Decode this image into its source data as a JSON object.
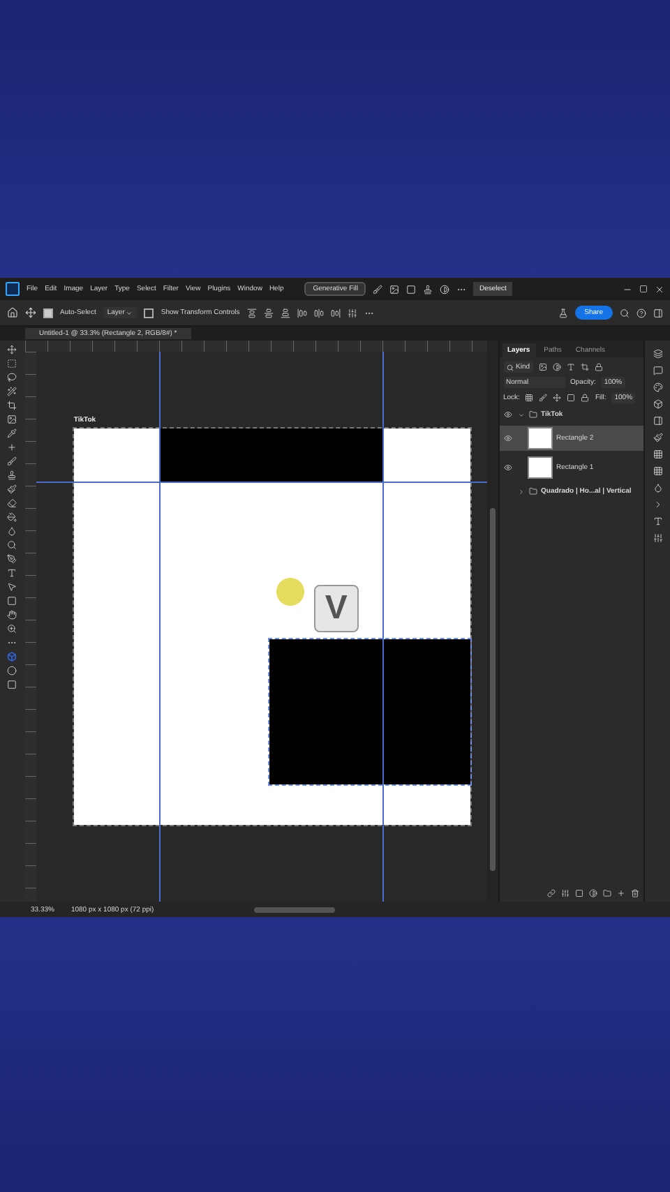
{
  "menu": [
    "File",
    "Edit",
    "Image",
    "Layer",
    "Type",
    "Select",
    "Filter",
    "View",
    "Plugins",
    "Window",
    "Help"
  ],
  "generative_fill": "Generative Fill",
  "deselect": "Deselect",
  "options": {
    "auto_select": {
      "label": "Auto-Select",
      "checked": true
    },
    "target": "Layer",
    "transform": {
      "label": "Show Transform Controls",
      "checked": false
    }
  },
  "share": "Share",
  "document_tab": "Untitled-1 @ 33.3% (Rectangle 2, RGB/8#) *",
  "artboard": {
    "name": "TikTok"
  },
  "key_overlay": "V",
  "layers_panel": {
    "tabs": [
      {
        "label": "Layers",
        "selected": true
      },
      {
        "label": "Paths",
        "selected": false
      },
      {
        "label": "Channels",
        "selected": false
      }
    ],
    "filter": "Kind",
    "blend_mode": "Normal",
    "opacity_label": "Opacity:",
    "opacity": "100%",
    "lock_label": "Lock:",
    "fill_label": "Fill:",
    "fill": "100%",
    "layers": [
      {
        "name": "TikTok",
        "kind": "group",
        "visible": true,
        "expanded": true,
        "selected": false,
        "children": [
          {
            "name": "Rectangle 2",
            "kind": "layer",
            "visible": true,
            "selected": true
          },
          {
            "name": "Rectangle 1",
            "kind": "layer",
            "visible": true,
            "selected": false
          }
        ]
      },
      {
        "name": "Quadrado | Ho...al | Vertical",
        "kind": "group",
        "visible": false,
        "expanded": false,
        "selected": false
      }
    ]
  },
  "status": {
    "zoom": "33.33%",
    "doc_size": "1080 px x 1080 px (72 ppi)"
  }
}
